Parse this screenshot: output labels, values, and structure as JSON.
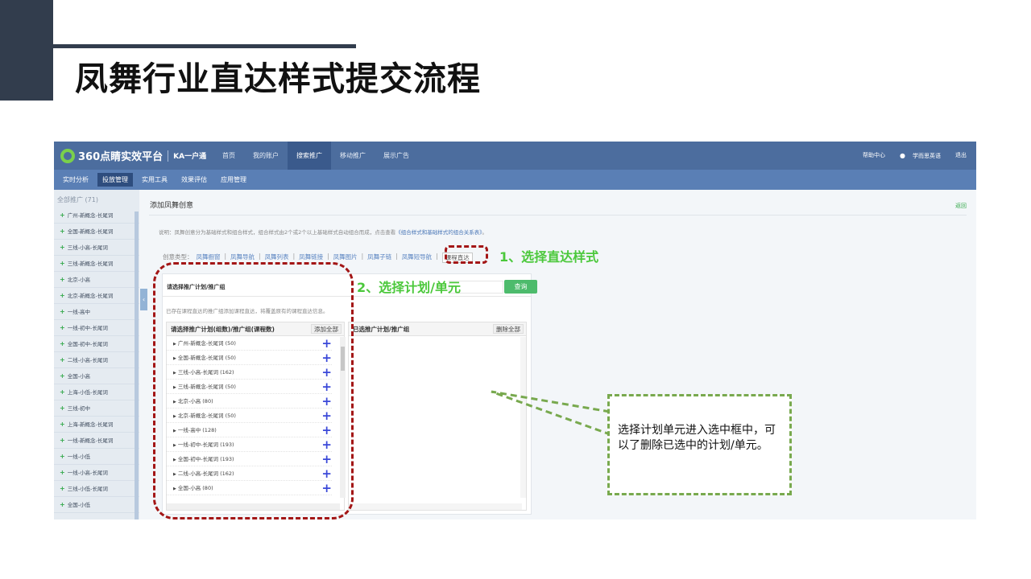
{
  "slide": {
    "title": "凤舞行业直达样式提交流程"
  },
  "app": {
    "logo_text": "360点睛实效平台",
    "logo_sub": "KA一户通",
    "topnav": [
      "首页",
      "我的账户",
      "搜索推广",
      "移动推广",
      "展示广告"
    ],
    "topnav_active": 2,
    "help": "帮助中心",
    "user": "学而思英语",
    "logout": "退出",
    "subnav": [
      "实时分析",
      "投放管理",
      "实用工具",
      "效果评估",
      "应用管理"
    ],
    "subnav_active": 1
  },
  "sidebar": {
    "header": "全部推广 (71)",
    "items": [
      "广州-新概念-长尾词",
      "全国-新概念-长尾词",
      "三线-小高-长尾词",
      "三线-新概念-长尾词",
      "北京-小高",
      "北京-新概念-长尾词",
      "一线-高中",
      "一线-初中-长尾词",
      "全国-初中-长尾词",
      "二线-小高-长尾词",
      "全国-小高",
      "上海-小低-长尾词",
      "三线-初中",
      "上海-新概念-长尾词",
      "一线-新概念-长尾词",
      "一线-小低",
      "一线-小高-长尾词",
      "三线-小低-长尾词",
      "全国-小低"
    ]
  },
  "main": {
    "title": "添加凤舞创意",
    "back": "返回",
    "desc_prefix": "说明：凤舞创意分为基础样式和组合样式，组合样式由2个或2个以上基础样式自动组合而成，点击查看",
    "desc_link": "《组合样式和基础样式的组合关系表》",
    "desc_suffix": "。",
    "types_label": "创意类型：",
    "types": [
      "凤舞橱窗",
      "凤舞导航",
      "凤舞列表",
      "凤舞链接",
      "凤舞图片",
      "凤舞子链",
      "凤舞短导航"
    ],
    "type_selected": "课程直达"
  },
  "panel": {
    "head_title": "请选择推广计划/推广组",
    "query": "查询",
    "note": "已存在课程直达的推广组添加课程直达，将覆盖原有的课程直达信息。",
    "left_header": "请选择推广计划(组数)/推广组(课程数)",
    "add_all": "添加全部",
    "right_header": "已选推广计划/推广组",
    "delete_all": "删除全部",
    "plans": [
      "广州-新概念-长尾词 (50)",
      "全国-新概念-长尾词 (50)",
      "三线-小高-长尾词 (162)",
      "三线-新概念-长尾词 (50)",
      "北京-小高 (80)",
      "北京-新概念-长尾词 (50)",
      "一线-高中 (128)",
      "一线-初中-长尾词 (193)",
      "全国-初中-长尾词 (193)",
      "二线-小高-长尾词 (162)",
      "全国-小高 (80)"
    ]
  },
  "annotations": {
    "step1": "1、选择直达样式",
    "step2": "2、选择计划/单元",
    "callout": "选择计划单元进入选中框中，可以了删除已选中的计划/单元。"
  },
  "colors": {
    "topbar": "#4c6d9e",
    "accent_green": "#4bc83b",
    "dash_red": "#a31616",
    "dash_green": "#78a94e"
  }
}
